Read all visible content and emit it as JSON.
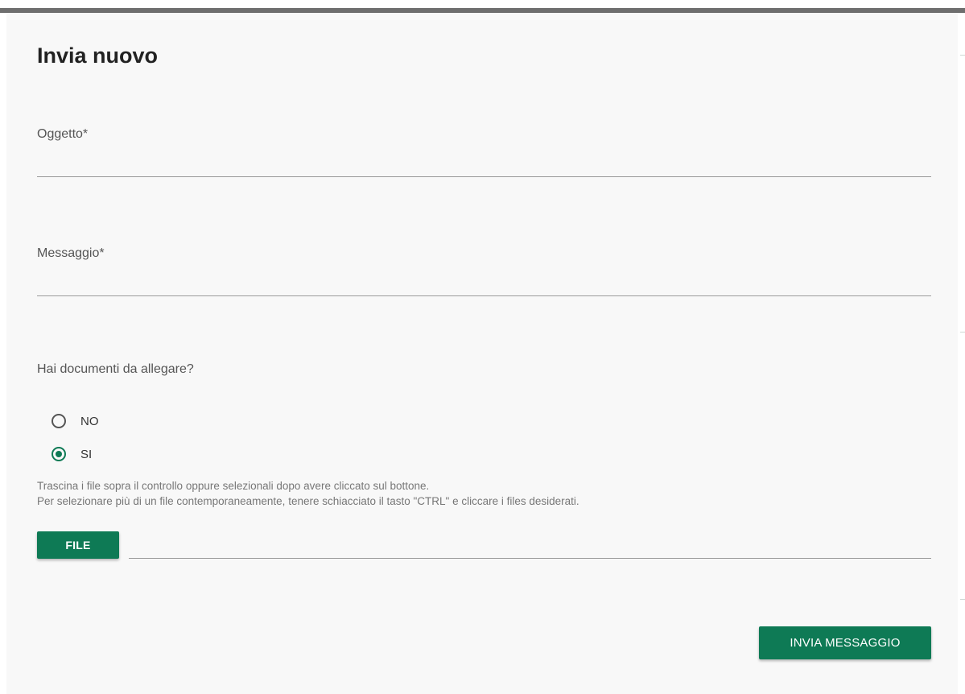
{
  "dialog": {
    "title": "Invia nuovo"
  },
  "form": {
    "subject": {
      "label": "Oggetto*",
      "value": ""
    },
    "message": {
      "label": "Messaggio*",
      "value": ""
    },
    "attachments": {
      "question": "Hai documenti da allegare?",
      "options": [
        {
          "label": "NO",
          "checked": false
        },
        {
          "label": "SI",
          "checked": true
        }
      ],
      "hint_line1": "Trascina i file sopra il controllo oppure selezionali dopo avere cliccato sul bottone.",
      "hint_line2": "Per selezionare più di un file contemporaneamente, tenere schiacciato il tasto \"CTRL\" e cliccare i files desiderati.",
      "file_button_label": "FILE",
      "file_value": ""
    },
    "submit_label": "INVIA MESSAGGIO"
  },
  "colors": {
    "accent": "#0e7a55",
    "background": "#f8f8f8"
  }
}
